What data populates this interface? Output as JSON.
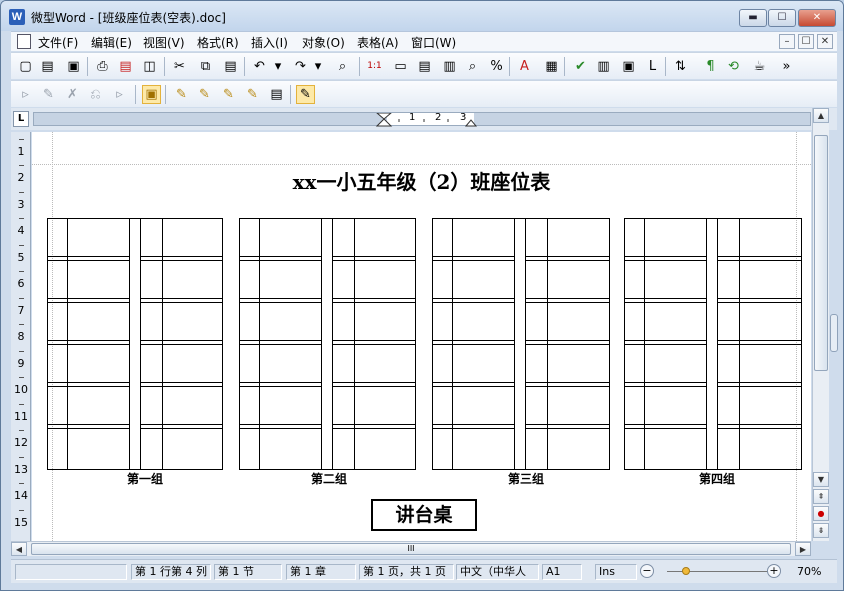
{
  "window": {
    "title": "微型Word - [班级座位表(空表).doc]",
    "app_icon": "W",
    "buttons": {
      "minimize": "▬",
      "maximize": "☐",
      "close": "✕"
    }
  },
  "menu": {
    "items": [
      "文件(F)",
      "编辑(E)",
      "视图(V)",
      "格式(R)",
      "插入(I)",
      "对象(O)",
      "表格(A)",
      "窗口(W)"
    ],
    "mdi_buttons": [
      "–",
      "☐",
      "✕"
    ]
  },
  "toolbar1": {
    "icons": [
      "new-icon",
      "open-icon",
      "save-icon",
      "print-icon",
      "pdf-icon",
      "print-preview-icon",
      "cut-icon",
      "copy-icon",
      "paste-icon",
      "undo-icon",
      "undo-dropdown-icon",
      "redo-icon",
      "redo-dropdown-icon",
      "find-icon",
      "actual-size-icon",
      "page-width-icon",
      "whole-page-icon",
      "two-pages-icon",
      "zoom-icon",
      "zoom-percent-icon",
      "font-color-icon",
      "format-icon",
      "spellcheck-icon",
      "columns-icon",
      "shadow-icon",
      "frame-icon",
      "track-icon",
      "paragraph-mark-icon",
      "tracking-icon",
      "tea-icon",
      "overflow-chevron-icon"
    ],
    "glyphs": [
      "▢",
      "▤",
      "▣",
      "⎙",
      "▤",
      "◫",
      "✂",
      "⧉",
      "▤",
      "↶",
      "▾",
      "↷",
      "▾",
      "⌕",
      "1:1",
      "▭",
      "▤",
      "▥",
      "⌕",
      "%",
      "A",
      "▦",
      "✔",
      "▥",
      "▣",
      "L",
      "⇅",
      "¶",
      "⟲",
      "☕",
      "»"
    ]
  },
  "toolbar2": {
    "icons": [
      "review-1-icon",
      "review-2-icon",
      "review-3-icon",
      "review-4-icon",
      "review-5-icon",
      "review-active-icon",
      "accept-icon",
      "accept-all-icon",
      "reject-icon",
      "reject-all-icon",
      "comment-icon",
      "edit-mark-icon"
    ],
    "glyphs": [
      "▹",
      "✎",
      "✗",
      "⎌",
      "▹",
      "▣",
      "✎",
      "✎",
      "✎",
      "✎",
      "▤",
      "✎"
    ]
  },
  "ruler": {
    "corner": "L",
    "h_numbers": [
      "1",
      "2",
      "3"
    ],
    "v_numbers": [
      "1",
      "2",
      "3",
      "4",
      "5",
      "6",
      "7",
      "8",
      "9",
      "10",
      "11",
      "12",
      "13",
      "14",
      "15"
    ]
  },
  "document": {
    "title": "xx一小五年级（2）班座位表",
    "groups": [
      "第一组",
      "第二组",
      "第三组",
      "第四组"
    ],
    "podium": "讲台桌",
    "rows_per_group": 6,
    "columns_per_group": 4
  },
  "scroll": {
    "up": "▲",
    "down": "▼",
    "prev_page": "⇞",
    "select_browse": "●",
    "next_page": "⇟",
    "left": "◀",
    "right": "▶",
    "grip": "III"
  },
  "status": {
    "position": "第 1 行第 4 列",
    "section": "第 1 节",
    "chapter": "第 1 章",
    "pages": "第 1 页，共 1 页",
    "language": "中文（中华人",
    "cell": "A1",
    "mode": "Ins",
    "zoom_minus": "−",
    "zoom_plus": "+",
    "zoom": "70%"
  }
}
